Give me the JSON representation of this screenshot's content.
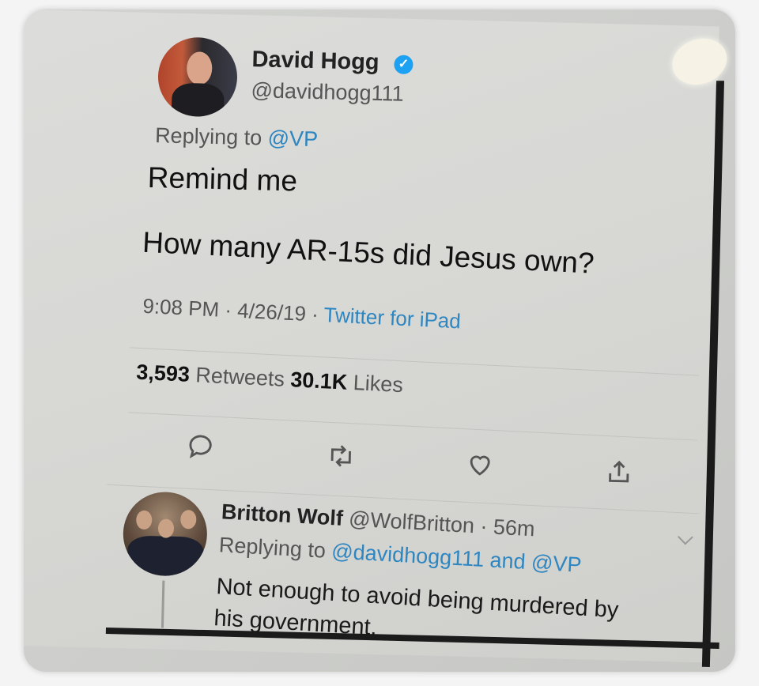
{
  "tweet": {
    "author_name": "David Hogg",
    "verified_badge": "✓",
    "handle": "@davidhogg111",
    "replying_prefix": "Replying to ",
    "replying_to": "@VP",
    "line1": "Remind me",
    "line2": "How many AR-15s did Jesus own?",
    "time": "9:08 PM",
    "sep1": " · ",
    "date": "4/26/19",
    "sep2": " · ",
    "source": "Twitter for iPad",
    "retweets_count": "3,593",
    "retweets_label": " Retweets  ",
    "likes_count": "30.1K",
    "likes_label": " Likes"
  },
  "actions": [
    {
      "name": "reply",
      "icon": "speech-bubble-icon"
    },
    {
      "name": "retweet",
      "icon": "retweet-icon"
    },
    {
      "name": "like",
      "icon": "heart-icon"
    },
    {
      "name": "share",
      "icon": "share-icon"
    }
  ],
  "reply": {
    "author_name": "Britton Wolf",
    "handle_time": " @WolfBritton · 56m",
    "replying_prefix": "Replying to ",
    "replying_to_1": "@davidhogg111",
    "and": " and ",
    "replying_to_2": "@VP",
    "text_line1": "Not enough to avoid being murdered by",
    "text_line2": "his government."
  },
  "colors": {
    "link": "#2e86c1",
    "verified": "#1da1f2"
  }
}
